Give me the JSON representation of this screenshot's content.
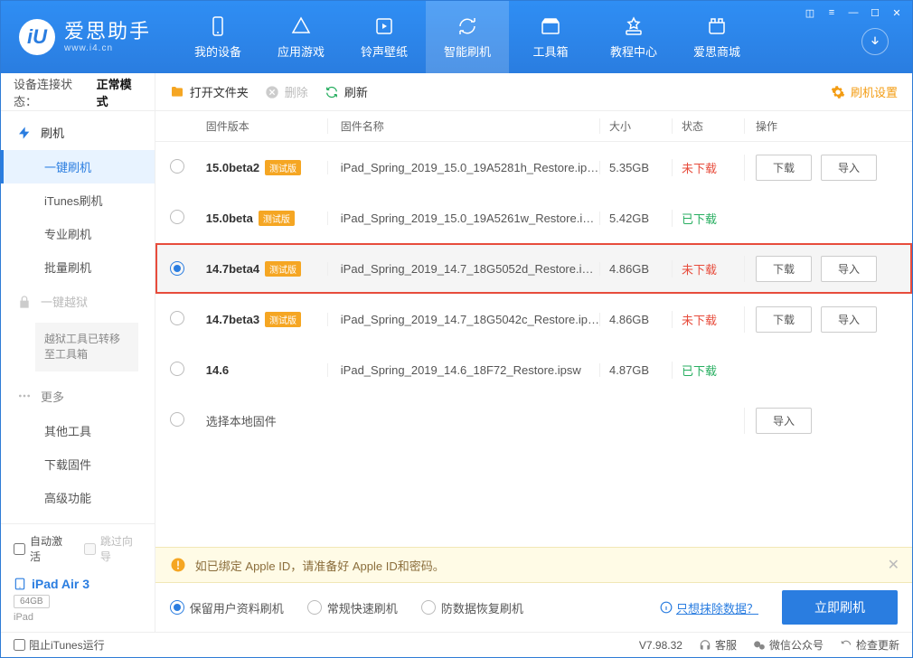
{
  "app": {
    "name": "爱思助手",
    "domain": "www.i4.cn"
  },
  "nav": [
    {
      "label": "我的设备"
    },
    {
      "label": "应用游戏"
    },
    {
      "label": "铃声壁纸"
    },
    {
      "label": "智能刷机"
    },
    {
      "label": "工具箱"
    },
    {
      "label": "教程中心"
    },
    {
      "label": "爱思商城"
    }
  ],
  "sidebar": {
    "status_label": "设备连接状态：",
    "status_value": "正常模式",
    "section_flash": "刷机",
    "items_flash": [
      "一键刷机",
      "iTunes刷机",
      "专业刷机",
      "批量刷机"
    ],
    "section_jailbreak": "一键越狱",
    "jailbreak_note": "越狱工具已转移至工具箱",
    "section_more": "更多",
    "items_more": [
      "其他工具",
      "下载固件",
      "高级功能"
    ],
    "auto_activate": "自动激活",
    "skip_guide": "跳过向导",
    "device_name": "iPad Air 3",
    "storage": "64GB",
    "device_type": "iPad",
    "block_itunes": "阻止iTunes运行"
  },
  "toolbar": {
    "open": "打开文件夹",
    "delete": "删除",
    "refresh": "刷新",
    "settings": "刷机设置"
  },
  "table": {
    "headers": {
      "version": "固件版本",
      "name": "固件名称",
      "size": "大小",
      "status": "状态",
      "ops": "操作"
    },
    "beta_badge": "测试版",
    "download_btn": "下载",
    "import_btn": "导入",
    "rows": [
      {
        "version": "15.0beta2",
        "beta": true,
        "name": "iPad_Spring_2019_15.0_19A5281h_Restore.ip…",
        "size": "5.35GB",
        "status_text": "未下载",
        "status_class": "status-red",
        "has_download": true,
        "has_import": true,
        "checked": false
      },
      {
        "version": "15.0beta",
        "beta": true,
        "name": "iPad_Spring_2019_15.0_19A5261w_Restore.i…",
        "size": "5.42GB",
        "status_text": "已下载",
        "status_class": "status-green",
        "has_download": false,
        "has_import": false,
        "checked": false
      },
      {
        "version": "14.7beta4",
        "beta": true,
        "name": "iPad_Spring_2019_14.7_18G5052d_Restore.i…",
        "size": "4.86GB",
        "status_text": "未下载",
        "status_class": "status-red",
        "has_download": true,
        "has_import": true,
        "checked": true,
        "highlight": true
      },
      {
        "version": "14.7beta3",
        "beta": true,
        "name": "iPad_Spring_2019_14.7_18G5042c_Restore.ip…",
        "size": "4.86GB",
        "status_text": "未下载",
        "status_class": "status-red",
        "has_download": true,
        "has_import": true,
        "checked": false
      },
      {
        "version": "14.6",
        "beta": false,
        "name": "iPad_Spring_2019_14.6_18F72_Restore.ipsw",
        "size": "4.87GB",
        "status_text": "已下载",
        "status_class": "status-green",
        "has_download": false,
        "has_import": false,
        "checked": false
      }
    ],
    "local_firmware": "选择本地固件"
  },
  "warning": "如已绑定 Apple ID，请准备好 Apple ID和密码。",
  "flash_options": [
    "保留用户资料刷机",
    "常规快速刷机",
    "防数据恢复刷机"
  ],
  "erase_link": "只想抹除数据？",
  "flash_now": "立即刷机",
  "statusbar": {
    "version": "V7.98.32",
    "service": "客服",
    "wechat": "微信公众号",
    "update": "检查更新"
  }
}
